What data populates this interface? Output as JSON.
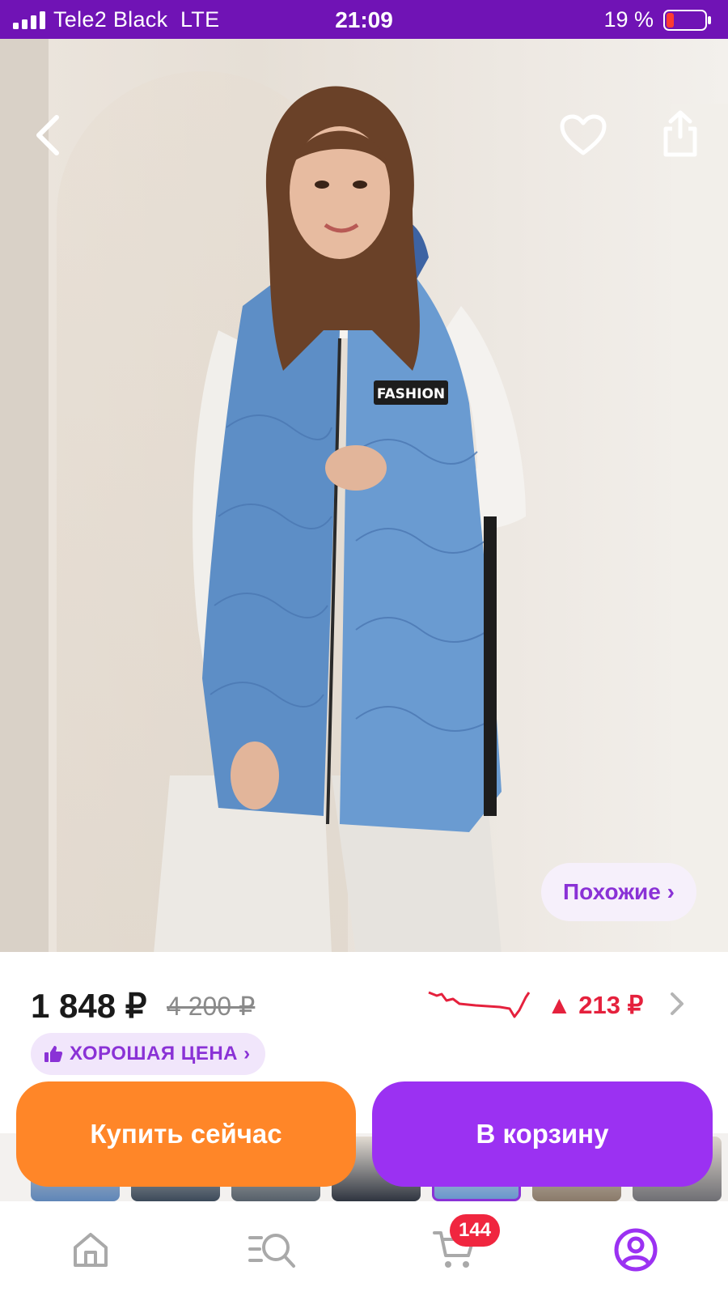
{
  "status_bar": {
    "carrier": "Tele2 Black",
    "network": "LTE",
    "time": "21:09",
    "battery_percent": "19 %",
    "battery_level": 0.19,
    "signal_bars": 4
  },
  "product_image": {
    "badge_text": "FASHION",
    "similar_label": "Похожие ›",
    "icons": [
      "back-icon",
      "heart-icon",
      "share-icon"
    ]
  },
  "price": {
    "current": "1 848 ₽",
    "old": "4 200 ₽",
    "change": "▲ 213 ₽",
    "good_price_label": "ХОРОШАЯ ЦЕНА ›"
  },
  "actions": {
    "buy_now": "Купить сейчас",
    "add_to_cart": "В корзину"
  },
  "bottom_nav": {
    "items": [
      "home",
      "catalog-search",
      "cart",
      "profile"
    ],
    "cart_count": "144",
    "active": "profile"
  },
  "colors": {
    "status_bar": "#7013b5",
    "accent_purple": "#9b31f2",
    "accent_orange": "#ff8628",
    "price_up_red": "#e5213d",
    "badge_red": "#f0263f"
  }
}
